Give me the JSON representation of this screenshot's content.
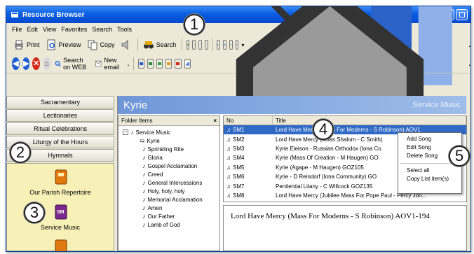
{
  "window": {
    "title": "Resource Browser"
  },
  "menu": [
    "File",
    "Edit",
    "View",
    "Favorites",
    "Search",
    "Tools"
  ],
  "toolbar1": {
    "print": "Print",
    "preview": "Preview",
    "copy": "Copy",
    "search": "Search"
  },
  "toolbar2": {
    "search_web": "Search on WEB",
    "new_email": "New email"
  },
  "nav": {
    "buttons": [
      "Sacramentary",
      "Lectionaries",
      "Ritual Celebrations",
      "Liturgy of the Hours",
      "Hymnals"
    ],
    "repertoire_label": "Our Parish Repertoire",
    "service_music_label": "Service Music",
    "sm_badge": "SM"
  },
  "header": {
    "heading": "Kyrie",
    "section": "Service Music"
  },
  "folder": {
    "title": "Folder Items",
    "close": "×",
    "root": "Service Music",
    "items": [
      "Kyrie",
      "Sprinkling Rite",
      "Gloria",
      "Gospel Acclamation",
      "Creed",
      "General Intercessions",
      "Holy, holy, holy",
      "Memorial Acclamation",
      "Amen",
      "Our Father",
      "Lamb of God"
    ]
  },
  "list": {
    "columns": [
      "No",
      "Title"
    ],
    "rows": [
      {
        "no": "SM1",
        "title": "Lord Have Mercy (Mass For Moderns - S Robinson) AOV1"
      },
      {
        "no": "SM2",
        "title": "Lord Have Mercy (Mass Shalom - C Smith)"
      },
      {
        "no": "SM3",
        "title": "Kyrie Eleison - Russian Orthodox (Iona Co"
      },
      {
        "no": "SM4",
        "title": "Kyrie (Mass Of Creation - M Haugen) GO"
      },
      {
        "no": "SM5",
        "title": "Kyrie (Agape - M Haugen) GOZ105"
      },
      {
        "no": "SM6",
        "title": "Kyrie - D Reindorf (Iona Community) GO"
      },
      {
        "no": "SM7",
        "title": "Penitential Litany - C Willcock GOZ135"
      },
      {
        "no": "SM8",
        "title": "Lord Have Mercy (Jubilee Mass For Pope Paul - Percy Jon..."
      }
    ],
    "selected_index": 0
  },
  "detail": {
    "text": "Lord Have Mercy (Mass For Moderns - S Robinson) AOV1-194"
  },
  "context_menu": {
    "group1": [
      "Add Song",
      "Edit Song",
      "Delete Song"
    ],
    "group2": [
      "Select all",
      "Copy List item(s)"
    ]
  },
  "callouts": [
    "1",
    "2",
    "3",
    "4",
    "5"
  ],
  "colors": {
    "title_bar": "#0a5ee0",
    "selection": "#316ac5",
    "header_bar": "#6f97d8",
    "repertoire_bg": "#f7f1b8"
  }
}
